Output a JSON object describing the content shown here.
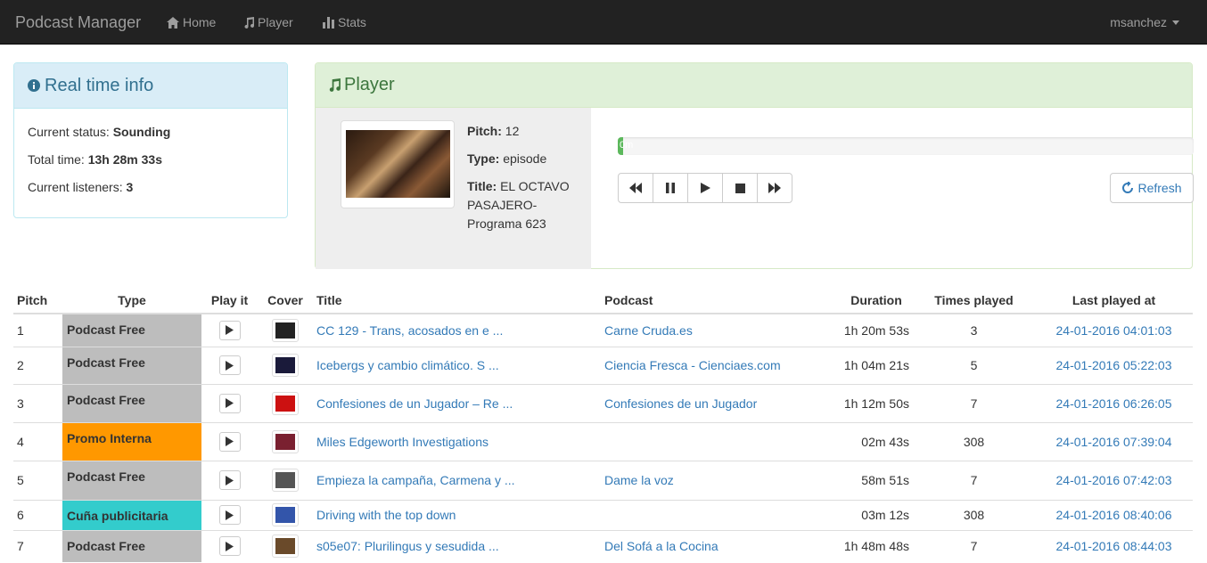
{
  "navbar": {
    "brand": "Podcast Manager",
    "links": [
      {
        "label": "Home",
        "icon": "home-icon"
      },
      {
        "label": "Player",
        "icon": "music-icon"
      },
      {
        "label": "Stats",
        "icon": "stats-icon"
      }
    ],
    "user": "msanchez"
  },
  "realtime": {
    "title": "Real time info",
    "status_label": "Current status:",
    "status_value": "Sounding",
    "total_label": "Total time:",
    "total_value": "13h 28m 33s",
    "listeners_label": "Current listeners:",
    "listeners_value": "3"
  },
  "player": {
    "title": "Player",
    "pitch_label": "Pitch:",
    "pitch_value": "12",
    "type_label": "Type:",
    "type_value": "episode",
    "title_label": "Title:",
    "title_value": "EL OCTAVO PASAJERO-Programa 623",
    "progress_text": "0m",
    "progress_fraction": 0.01,
    "refresh_label": "Refresh"
  },
  "table": {
    "headers": [
      "Pitch",
      "Type",
      "Play it",
      "Cover",
      "Title",
      "Podcast",
      "Duration",
      "Times played",
      "Last played at"
    ],
    "rows": [
      {
        "pitch": "1",
        "type": "Podcast Free",
        "type_class": "free",
        "title": "CC 129 - Trans, acosados en e ...",
        "podcast": "Carne Cruda.es",
        "duration": "1h 20m 53s",
        "times": "3",
        "last": "24-01-2016 04:01:03",
        "cover_color": "#222"
      },
      {
        "pitch": "2",
        "type": "Podcast Free",
        "type_class": "free",
        "title": "Icebergs y cambio climático. S ...",
        "podcast": "Ciencia Fresca - Cienciaes.com",
        "duration": "1h 04m 21s",
        "times": "5",
        "last": "24-01-2016 05:22:03",
        "cover_color": "#1a1a3a"
      },
      {
        "pitch": "3",
        "type": "Podcast Free",
        "type_class": "free",
        "title": "Confesiones de un Jugador – Re ...",
        "podcast": "Confesiones de un Jugador",
        "duration": "1h 12m 50s",
        "times": "7",
        "last": "24-01-2016 06:26:05",
        "cover_color": "#cc1111"
      },
      {
        "pitch": "4",
        "type": "Promo Interna",
        "type_class": "promo",
        "title": "Miles Edgeworth Investigations",
        "podcast": "",
        "duration": "02m 43s",
        "times": "308",
        "last": "24-01-2016 07:39:04",
        "cover_color": "#7a2030"
      },
      {
        "pitch": "5",
        "type": "Podcast Free",
        "type_class": "free",
        "title": "Empieza la campaña, Carmena y ...",
        "podcast": "Dame la voz",
        "duration": "58m 51s",
        "times": "7",
        "last": "24-01-2016 07:42:03",
        "cover_color": "#555"
      },
      {
        "pitch": "6",
        "type": "Cuña publicitaria",
        "type_class": "cuna",
        "title": "Driving with the top down",
        "podcast": "",
        "duration": "03m 12s",
        "times": "308",
        "last": "24-01-2016 08:40:06",
        "cover_color": "#3355aa"
      },
      {
        "pitch": "7",
        "type": "Podcast Free",
        "type_class": "free",
        "title": "s05e07: Plurilingus y sesudida ...",
        "podcast": "Del Sofá a la Cocina",
        "duration": "1h 48m 48s",
        "times": "7",
        "last": "24-01-2016 08:44:03",
        "cover_color": "#6a4a2a"
      }
    ]
  }
}
